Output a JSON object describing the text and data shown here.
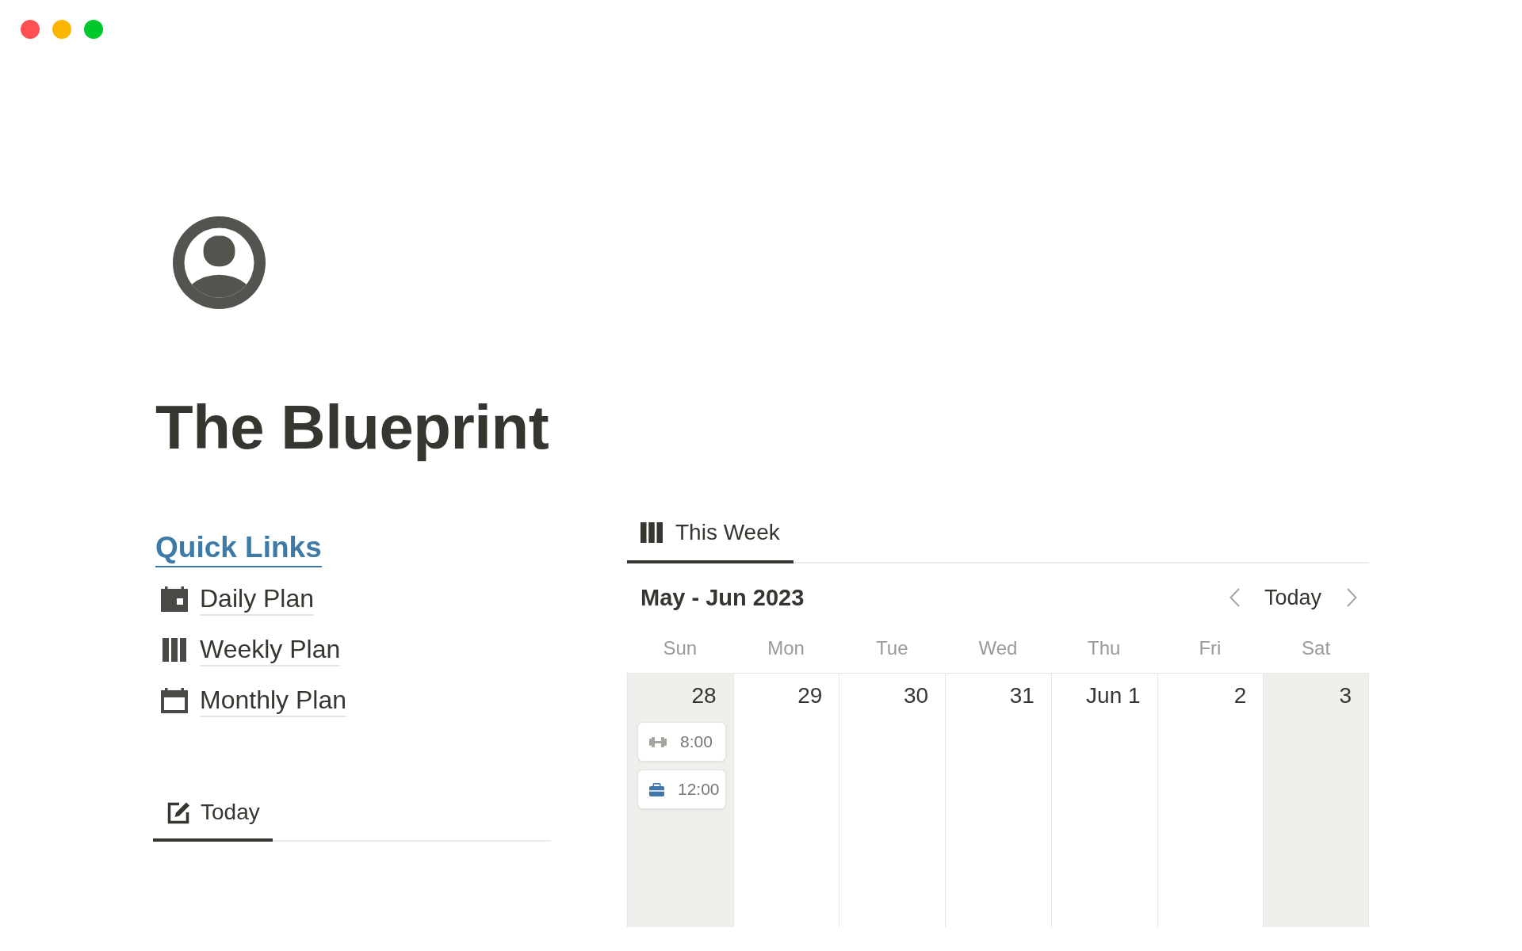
{
  "window": {
    "controls": [
      {
        "color": "#fe5053"
      },
      {
        "color": "#fdb600"
      },
      {
        "color": "#00c82a"
      }
    ]
  },
  "page": {
    "title": "The Blueprint"
  },
  "quick_links": {
    "heading": "Quick Links",
    "items": [
      {
        "kind": "day",
        "label": "Daily Plan"
      },
      {
        "kind": "week",
        "label": "Weekly Plan"
      },
      {
        "kind": "month",
        "label": "Monthly Plan"
      }
    ]
  },
  "today_view": {
    "tabs": [
      {
        "label": "Today",
        "selected": true
      }
    ]
  },
  "week_view": {
    "tabs": [
      {
        "label": "This Week",
        "selected": true
      }
    ],
    "range": "May - Jun 2023",
    "today_button": "Today",
    "weekdays": [
      "Sun",
      "Mon",
      "Tue",
      "Wed",
      "Thu",
      "Fri",
      "Sat"
    ],
    "days": [
      {
        "date": "28",
        "weekend": true,
        "events": [
          {
            "kind": "exercise",
            "color": "#a8a39d",
            "time": "8:00"
          },
          {
            "kind": "work",
            "color": "#3f78a8",
            "time": "12:00"
          }
        ]
      },
      {
        "date": "29",
        "weekend": false
      },
      {
        "date": "30",
        "weekend": false
      },
      {
        "date": "31",
        "weekend": false
      },
      {
        "date": "Jun 1",
        "weekend": false
      },
      {
        "date": "2",
        "weekend": false
      },
      {
        "date": "3",
        "weekend": true
      }
    ]
  }
}
